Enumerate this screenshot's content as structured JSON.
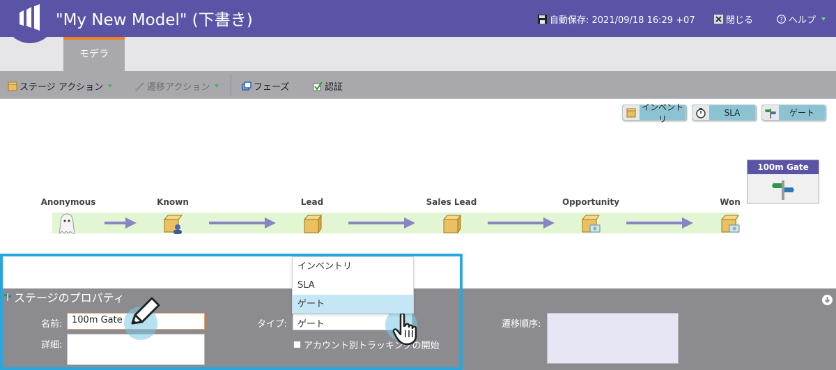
{
  "header": {
    "title": "\"My New Model\" (下書き)",
    "autosave": "自動保存: 2021/09/18 16:29 +07",
    "close_label": "閉じる",
    "help_label": "ヘルプ"
  },
  "tabs": [
    {
      "label": "モデラ",
      "active": true
    }
  ],
  "toolbar": {
    "stage_actions": "ステージ アクション",
    "transition_actions": "遷移アクション",
    "phases": "フェーズ",
    "approve": "認証"
  },
  "canvas_buttons": {
    "inventory": "インベントリ",
    "sla": "SLA",
    "gate": "ゲート"
  },
  "gate_box": {
    "title": "100m Gate",
    "icon": "signpost-icon"
  },
  "stages": [
    {
      "label": "Anonymous",
      "icon": "ghost-icon"
    },
    {
      "label": "Known",
      "icon": "box-person-icon"
    },
    {
      "label": "Lead",
      "icon": "box-icon"
    },
    {
      "label": "Sales Lead",
      "icon": "box-icon"
    },
    {
      "label": "Opportunity",
      "icon": "box-money-icon"
    },
    {
      "label": "Won",
      "icon": "box-money-icon"
    }
  ],
  "properties": {
    "title": "ステージのプロパティ",
    "name_label": "名前:",
    "name_value": "100m Gate",
    "detail_label": "詳細:",
    "type_label": "タイプ:",
    "type_value": "ゲート",
    "type_options": [
      "インベントリ",
      "SLA",
      "ゲート"
    ],
    "selected_option_index": 2,
    "account_tracking_label": "アカウント別トラッキングの開始",
    "transition_order_label": "遷移順序:"
  },
  "colors": {
    "header_bg": "#5a53a6",
    "tab_accent": "#f07f2a",
    "toolbar_bg": "#a9a9ad",
    "stage_band": "#e3f6d3",
    "arrow": "#8a84c4",
    "panel_bg": "#8c8c90",
    "highlight_frame": "#2aa6dc"
  }
}
